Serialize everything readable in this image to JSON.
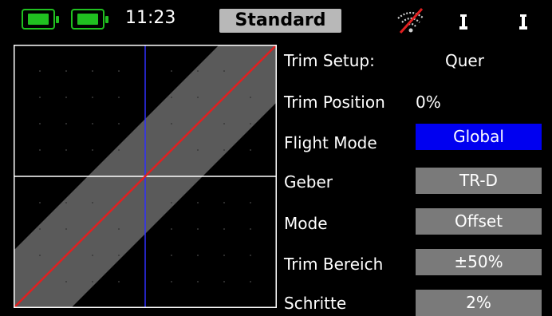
{
  "status_bar": {
    "time": "11:23",
    "model_name": "Standard",
    "battery_color": "#20c020",
    "icons": [
      "battery-icon",
      "battery-icon",
      "wifi-off-icon",
      "switch-icon",
      "switch-icon"
    ]
  },
  "trim": {
    "setup_label": "Trim Setup:",
    "setup_value": "Quer",
    "position_label": "Trim Position",
    "position_value": "0%",
    "flight_mode_label": "Flight Mode",
    "flight_mode_value": "Global",
    "geber_label": "Geber",
    "geber_value": "TR-D",
    "mode_label": "Mode",
    "mode_value": "Offset",
    "bereich_label": "Trim Bereich",
    "bereich_value": "±50%",
    "schritte_label": "Schritte",
    "schritte_value": "2%"
  },
  "colors": {
    "active_button": "#0000f0",
    "button": "#7a7a7a",
    "curve": "#e02020",
    "cursor": "#3030ff",
    "band": "#5a5a5a"
  }
}
